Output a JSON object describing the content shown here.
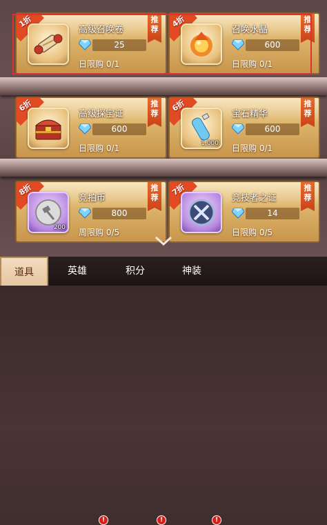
{
  "items": [
    {
      "name": "高级召唤卷",
      "price": "25",
      "limit": "日限购 0/1",
      "discount": "1折",
      "tag": "推荐",
      "icon": "scroll-icon",
      "qty": ""
    },
    {
      "name": "召唤水晶",
      "price": "600",
      "limit": "日限购 0/1",
      "discount": "4折",
      "tag": "推荐",
      "icon": "fire-crystal-icon",
      "qty": ""
    },
    {
      "name": "高级探宝证",
      "price": "600",
      "limit": "日限购 0/1",
      "discount": "6折",
      "tag": "推荐",
      "icon": "treasure-chest-icon",
      "qty": ""
    },
    {
      "name": "宝石精华",
      "price": "600",
      "limit": "日限购 0/1",
      "discount": "6折",
      "tag": "推荐",
      "icon": "potion-vial-icon",
      "qty": "1,000"
    },
    {
      "name": "竞拍币",
      "price": "800",
      "limit": "周限购 0/5",
      "discount": "8折",
      "tag": "推荐",
      "icon": "auction-coin-icon",
      "qty": "200"
    },
    {
      "name": "竞技者之证",
      "price": "14",
      "limit": "日限购 0/5",
      "discount": "7折",
      "tag": "推荐",
      "icon": "arena-badge-icon",
      "qty": ""
    }
  ],
  "tabs": [
    {
      "label": "道具",
      "active": true,
      "badge": ""
    },
    {
      "label": "英雄",
      "active": false,
      "badge": "!"
    },
    {
      "label": "积分",
      "active": false,
      "badge": "!"
    },
    {
      "label": "神装",
      "active": false,
      "badge": "!"
    }
  ],
  "colors": {
    "accent": "#e24a23",
    "selection": "#e0302f",
    "card": "#dcb36a"
  }
}
